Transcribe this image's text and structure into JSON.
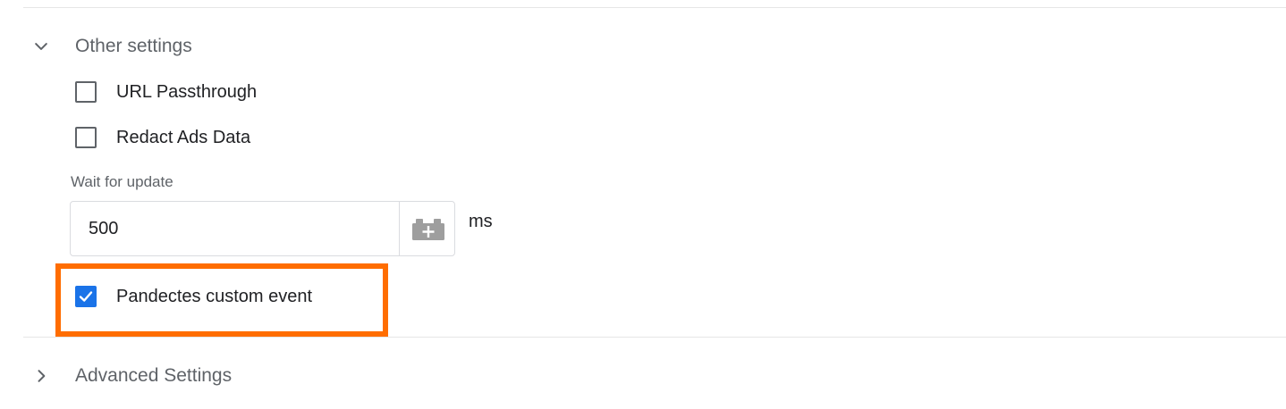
{
  "other_settings": {
    "title": "Other settings",
    "expanded": true,
    "icon": "chevron-down-icon"
  },
  "url_passthrough": {
    "label": "URL Passthrough",
    "checked": false
  },
  "redact_ads_data": {
    "label": "Redact Ads Data",
    "checked": false
  },
  "wait_for_update": {
    "label": "Wait for update",
    "value": "500",
    "unit": "ms",
    "variable_icon": "lego-brick-add-variable-icon"
  },
  "pandectes_custom_event": {
    "label": "Pandectes custom event",
    "checked": true
  },
  "highlight_color": "#ff6d00",
  "accent_color": "#1a73e8",
  "advanced_settings": {
    "title": "Advanced Settings",
    "expanded": false,
    "icon": "chevron-right-icon"
  }
}
